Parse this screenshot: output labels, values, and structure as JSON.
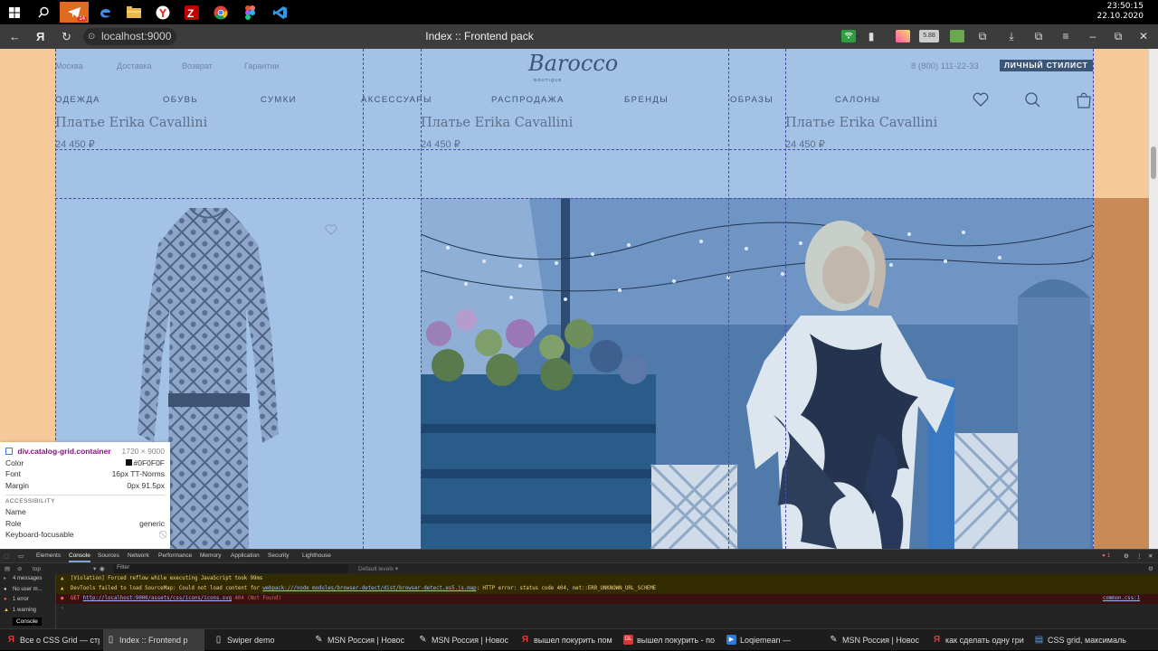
{
  "system": {
    "clock_time": "23:50:15",
    "clock_date": "22.10.2020",
    "pinned_apps": [
      "windows-start",
      "search",
      "telegram",
      "edge",
      "file-explorer",
      "yandex-browser",
      "filezilla",
      "chrome",
      "figma",
      "vscode"
    ],
    "telegram_badge": "14"
  },
  "browser": {
    "url": "localhost:9000",
    "tab_title": "Index :: Frontend pack",
    "extension_badge": "5.88"
  },
  "site": {
    "top_links": [
      "Москва",
      "Доставка",
      "Возврат",
      "Гарантии"
    ],
    "phone": "8 (800) 111-22-33",
    "stylist_button": "ЛИЧНЫЙ СТИЛИСТ",
    "logo_text": "Barocco",
    "logo_subtitle": "BOUTIQUE",
    "nav": [
      "ОДЕЖДА",
      "ОБУВЬ",
      "СУМКИ",
      "АКСЕССУАРЫ",
      "РАСПРОДАЖА",
      "БРЕНДЫ",
      "ОБРАЗЫ",
      "САЛОНЫ"
    ],
    "products": [
      {
        "title": "Платье Erika Cavallini",
        "price": "24 450 ₽"
      },
      {
        "title": "Платье Erika Cavallini",
        "price": "24 450 ₽"
      },
      {
        "title": "Платье Erika Cavallini",
        "price": "24 450 ₽"
      }
    ]
  },
  "inspector_tooltip": {
    "selector": "div.catalog-grid.container",
    "size": "1720 × 9000",
    "rows": [
      {
        "label": "Color",
        "value": "#0F0F0F"
      },
      {
        "label": "Font",
        "value": "16px TT-Norms"
      },
      {
        "label": "Margin",
        "value": "0px 91.5px"
      }
    ],
    "accessibility_title": "ACCESSIBILITY",
    "accessibility_rows": [
      {
        "label": "Name",
        "value": ""
      },
      {
        "label": "Role",
        "value": "generic"
      },
      {
        "label": "Keyboard-focusable",
        "value": ""
      }
    ]
  },
  "devtools": {
    "tabs": [
      "Elements",
      "Console",
      "Sources",
      "Network",
      "Performance",
      "Memory",
      "Application",
      "Security",
      "Lighthouse"
    ],
    "active_tab": "Console",
    "error_count": "1",
    "context": "top",
    "filter_placeholder": "Filter",
    "levels": "Default levels ▾",
    "sidebar": [
      "4 messages",
      "No user m...",
      "1 error",
      "1 warning"
    ],
    "log": [
      {
        "type": "warn",
        "text": "[Violation] Forced reflow while executing JavaScript took 99ms"
      },
      {
        "type": "warn",
        "prefix": "DevTools failed to load SourceMap: Could not load content for ",
        "link": "webpack:///node_modules/browser-detect/dist/browser-detect.es5.js.map",
        "suffix": ": HTTP error: status code 404, net::ERR_UNKNOWN_URL_SCHEME"
      },
      {
        "type": "err",
        "prefix": "GET ",
        "link": "http://localhost:9000/assets/css/icons/icons.svg",
        "suffix": " 404 (Not Found)",
        "source": "common.css:1"
      }
    ],
    "console_badge": "Console"
  },
  "taskbar": [
    {
      "label": "Все о CSS Grid — стр",
      "icon": "yandex"
    },
    {
      "label": "Index :: Frontend p",
      "icon": "page",
      "active": true
    },
    {
      "label": "Swiper demo",
      "icon": "page"
    },
    {
      "label": "MSN Россия | Новос",
      "icon": "msn"
    },
    {
      "label": "MSN Россия | Новос",
      "icon": "msn"
    },
    {
      "label": "вышел покурить пом",
      "icon": "yandex"
    },
    {
      "label": "вышел покурить - по",
      "icon": "gitlab"
    },
    {
      "label": "Loqiemean — ",
      "icon": "video"
    },
    {
      "label": "MSN Россия | Новос",
      "icon": "msn"
    },
    {
      "label": "как сделать одну гри",
      "icon": "yandex"
    },
    {
      "label": "CSS grid, максималь",
      "icon": "so"
    }
  ],
  "colors": {
    "grid_overlay": "#a3c2e6",
    "margin_overlay": "#f6c99a",
    "brand": "#3c5677"
  }
}
